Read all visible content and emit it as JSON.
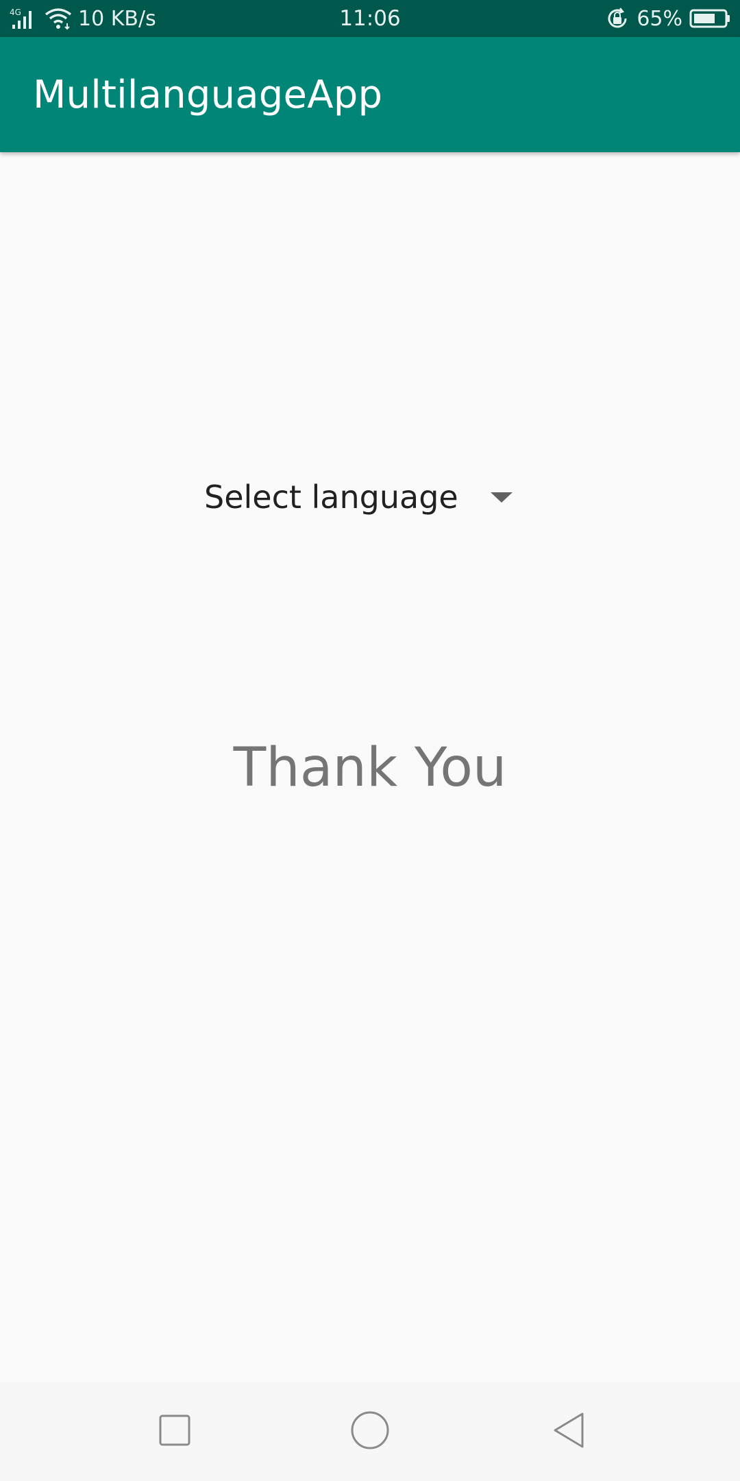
{
  "status_bar": {
    "network": "4G",
    "speed": "10 KB/s",
    "time": "11:06",
    "battery": "65%",
    "icons": [
      "signal-icon",
      "wifi-icon",
      "rotation-lock-icon",
      "battery-icon"
    ]
  },
  "app_bar": {
    "title": "MultilanguageApp",
    "color": "#008577"
  },
  "main": {
    "spinner": {
      "selected": "Select language"
    },
    "message": "Thank You"
  },
  "nav_bar": {
    "icons": [
      "recents-icon",
      "home-icon",
      "back-icon"
    ]
  },
  "colors": {
    "status_bar": "#00574b",
    "app_bar": "#008577",
    "background": "#fafafa"
  }
}
